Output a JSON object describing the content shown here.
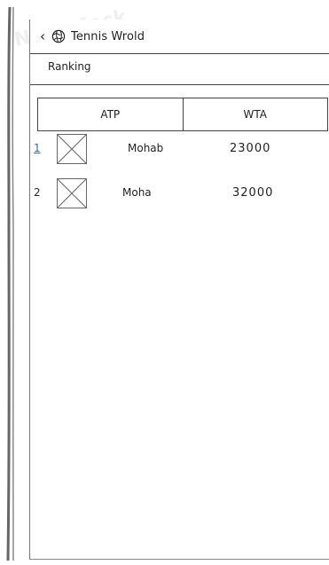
{
  "header": {
    "title": "Tennis Wrold",
    "back_icon": "back-icon",
    "globe_icon": "globe-icon"
  },
  "subheader": {
    "label": "Ranking"
  },
  "tabs": [
    {
      "label": "ATP"
    },
    {
      "label": "WTA"
    }
  ],
  "rows": [
    {
      "rank": "1",
      "name": "Mohab",
      "score": "23000"
    },
    {
      "rank": "2",
      "name": "Moha",
      "score": "32000"
    }
  ]
}
